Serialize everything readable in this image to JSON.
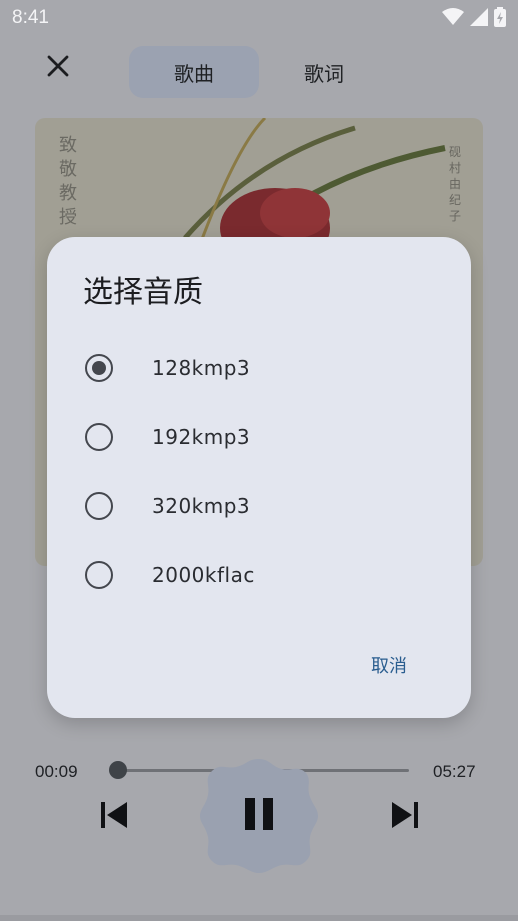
{
  "status_bar": {
    "time": "8:41",
    "icons": [
      "wifi-icon",
      "signal-icon",
      "battery-icon"
    ]
  },
  "top_bar": {
    "close_icon": "close-icon",
    "tabs": [
      {
        "label": "歌曲",
        "selected": true
      },
      {
        "label": "歌词",
        "selected": false
      }
    ]
  },
  "album": {
    "title_vertical": "致敬教授",
    "artist_vertical": "砚村由纪子"
  },
  "player": {
    "current_time": "00:09",
    "total_time": "05:27",
    "progress": 0.03,
    "prev_icon": "skip-previous-icon",
    "pause_icon": "pause-icon",
    "next_icon": "skip-next-icon"
  },
  "dialog": {
    "title": "选择音质",
    "options": [
      {
        "label": "128kmp3",
        "selected": true
      },
      {
        "label": "192kmp3",
        "selected": false
      },
      {
        "label": "320kmp3",
        "selected": false
      },
      {
        "label": "2000kflac",
        "selected": false
      }
    ],
    "cancel_label": "取消"
  },
  "colors": {
    "dialog_bg": "#e3e6ef",
    "accent": "#2a5d8f",
    "tab_selected_bg": "#9ba2b1"
  }
}
